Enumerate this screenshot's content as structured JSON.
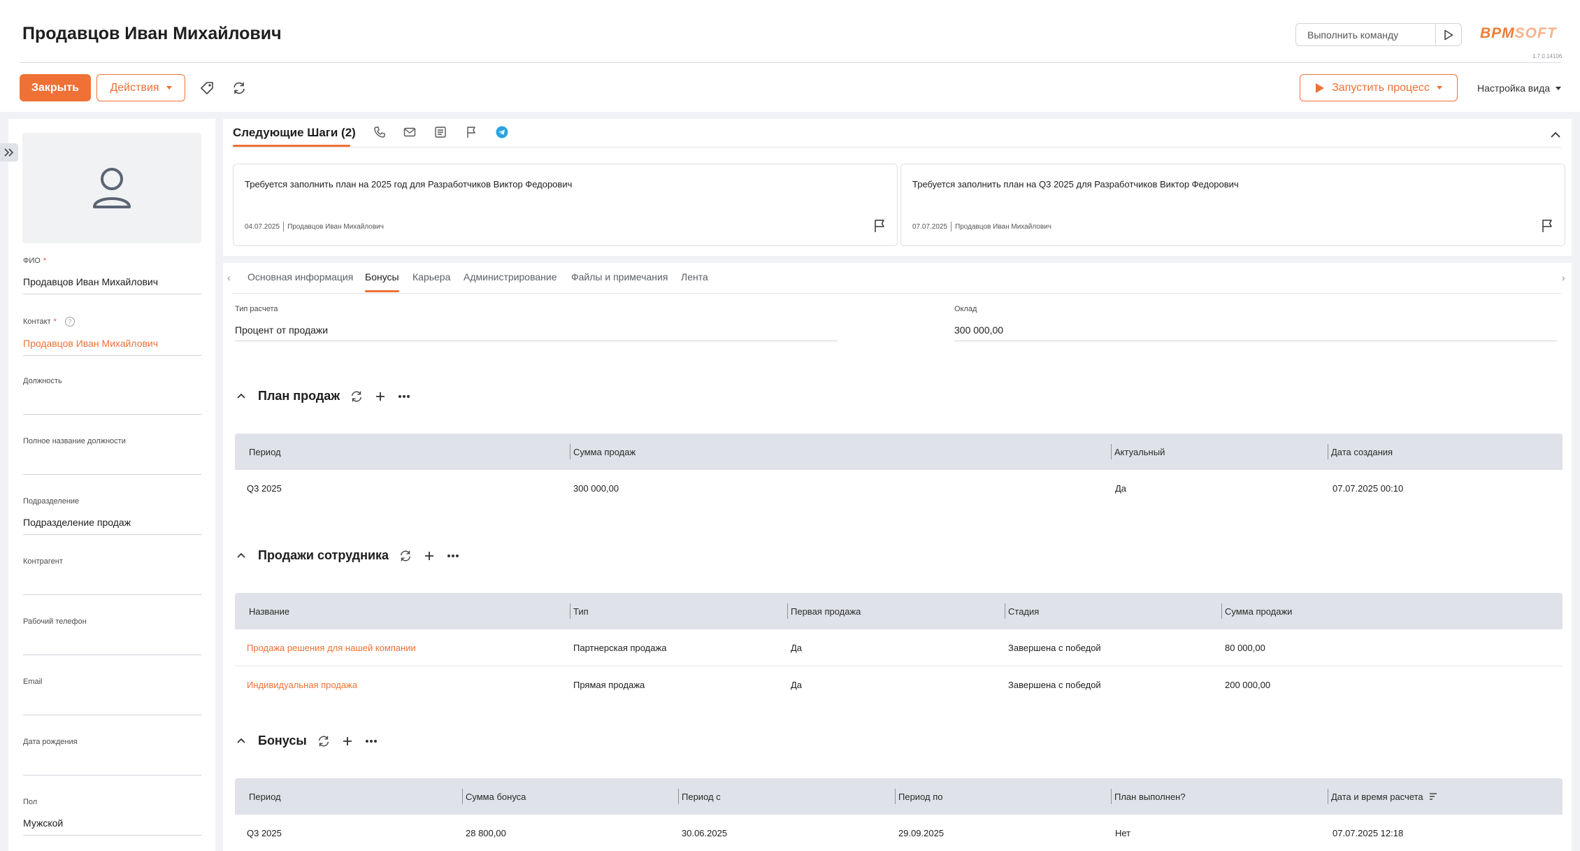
{
  "header": {
    "title": "Продавцов Иван Михайлович",
    "command_placeholder": "Выполнить команду",
    "logo_primary": "BPM",
    "logo_secondary": "SOFT",
    "version": "1.7.0.14106",
    "close_label": "Закрыть",
    "actions_label": "Действия",
    "run_process_label": "Запустить процесс",
    "view_settings_label": "Настройка вида"
  },
  "profile": {
    "fields": [
      {
        "label": "ФИО",
        "required": "*",
        "value": "Продавцов Иван Михайлович"
      },
      {
        "label": "Контакт",
        "required": "*",
        "value": "Продавцов Иван Михайлович"
      },
      {
        "label": "Должность",
        "value": ""
      },
      {
        "label": "Полное название должности",
        "value": ""
      },
      {
        "label": "Подразделение",
        "value": "Подразделение продаж"
      },
      {
        "label": "Контрагент",
        "value": ""
      },
      {
        "label": "Рабочий телефон",
        "value": ""
      },
      {
        "label": "Email",
        "value": ""
      },
      {
        "label": "Дата рождения",
        "value": ""
      },
      {
        "label": "Пол",
        "value": "Мужской"
      }
    ],
    "help_mark": "?"
  },
  "next_steps": {
    "title": "Следующие Шаги (2)",
    "cards": [
      {
        "title": "Требуется заполнить план на 2025 год для Разработчиков Виктор Федорович",
        "date": "04.07.2025",
        "owner": "Продавцов Иван Михайлович"
      },
      {
        "title": "Требуется заполнить план на Q3 2025 для Разработчиков Виктор Федорович",
        "date": "07.07.2025",
        "owner": "Продавцов Иван Михайлович"
      }
    ]
  },
  "tabs": [
    "Основная информация",
    "Бонусы",
    "Карьера",
    "Администрирование",
    "Файлы и примечания",
    "Лента"
  ],
  "bonus_fields": {
    "calc_type_label": "Тип расчета",
    "calc_type_value": "Процент от продажи",
    "salary_label": "Оклад",
    "salary_value": "300 000,00"
  },
  "sales_plan": {
    "title": "План продаж",
    "columns": [
      "Период",
      "Сумма продаж",
      "Актуальный",
      "Дата создания"
    ],
    "rows": [
      [
        "Q3 2025",
        "300 000,00",
        "Да",
        "07.07.2025 00:10"
      ]
    ]
  },
  "employee_sales": {
    "title": "Продажи сотрудника",
    "columns": [
      "Название",
      "Тип",
      "Первая продажа",
      "Стадия",
      "Сумма продажи"
    ],
    "rows": [
      [
        "Продажа решения для нашей компании",
        "Партнерская продажа",
        "Да",
        "Завершена с победой",
        "80 000,00"
      ],
      [
        "Индивидуальная продажа",
        "Прямая продажа",
        "Да",
        "Завершена с победой",
        "200 000,00"
      ]
    ]
  },
  "bonuses": {
    "title": "Бонусы",
    "columns": [
      "Период",
      "Сумма бонуса",
      "Период с",
      "Период по",
      "План выполнен?",
      "Дата и время расчета"
    ],
    "rows": [
      [
        "Q3 2025",
        "28 800,00",
        "30.06.2025",
        "29.09.2025",
        "Нет",
        "07.07.2025 12:18"
      ]
    ]
  },
  "colors": {
    "accent": "#ef7135",
    "grid_header": "#dfe2e8",
    "background": "#f1f2f5",
    "telegram": "#2aa3df"
  }
}
